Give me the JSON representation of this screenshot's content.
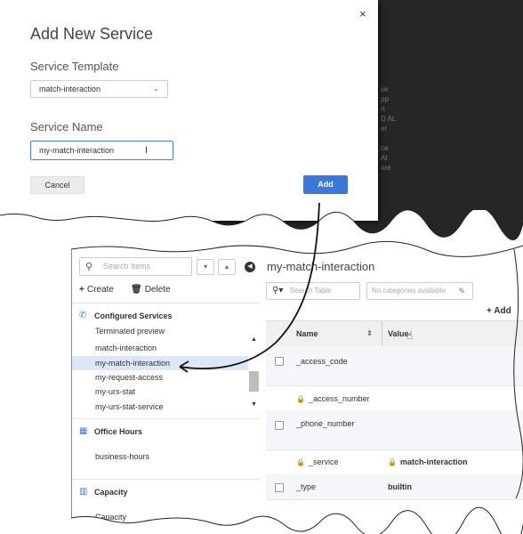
{
  "dialog": {
    "title": "Add New Service",
    "close": "×",
    "template_label": "Service Template",
    "template_value": "match-interaction",
    "name_label": "Service Name",
    "name_value": "my-match-interaction",
    "cancel_label": "Cancel",
    "add_label": "Add"
  },
  "background_fragment": "ve\npp\nrt\nD AL\ner\n\nce\nAt\nore",
  "sidebar": {
    "search_placeholder": "Search Items",
    "create_label": "Create",
    "delete_label": "Delete",
    "configured_services_label": "Configured Services",
    "services": [
      "Terminated preview",
      "match-interaction",
      "my-match-interaction",
      "my-request-access",
      "my-urs-stat",
      "my-urs-stat-service"
    ],
    "selected_index": 2,
    "office_hours_label": "Office Hours",
    "office_hours_items": [
      "business-hours"
    ],
    "capacity_label": "Capacity",
    "capacity_items": [
      "Capacity"
    ]
  },
  "main": {
    "title": "my-match-interaction",
    "search_placeholder": "Search Table",
    "categories_placeholder": "No categories available",
    "add_label": "Add",
    "columns": [
      "Name",
      "Value"
    ],
    "rows": [
      {
        "name": "_access_code",
        "value": "",
        "locked": false
      },
      {
        "name": "_access_number",
        "value": "",
        "locked": true
      },
      {
        "name": "_phone_number",
        "value": "",
        "locked": false
      },
      {
        "name": "_service",
        "value": "match-interaction",
        "locked": true
      },
      {
        "name": "_type",
        "value": "builtin",
        "locked": false
      }
    ]
  },
  "colors": {
    "accent": "#3b78d8",
    "selected_row": "#dce7f7",
    "dark_backdrop": "#262626"
  }
}
